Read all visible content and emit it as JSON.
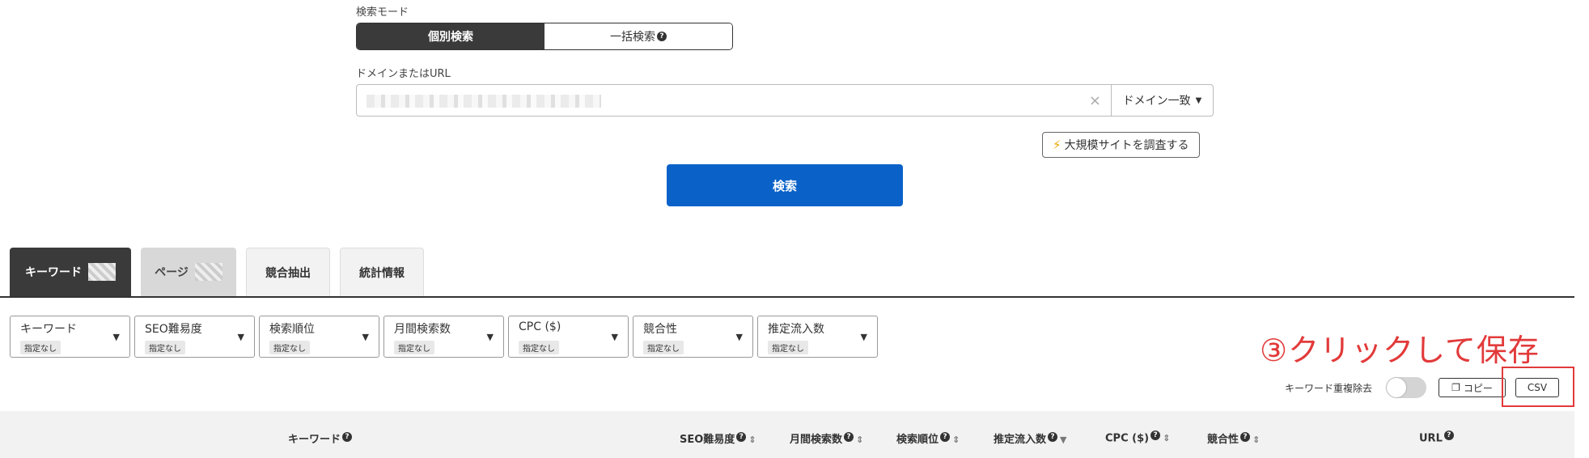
{
  "search_mode": {
    "label": "検索モード",
    "individual": "個別検索",
    "bulk": "一括検索"
  },
  "domain": {
    "label": "ドメインまたはURL",
    "match_select": "ドメイン一致"
  },
  "big_site_button": "大規模サイトを調査する",
  "search_button": "検索",
  "tabs": {
    "keyword": "キーワード",
    "page": "ページ",
    "competitor": "競合抽出",
    "stats": "統計情報"
  },
  "filters": [
    {
      "label": "キーワード",
      "badge": "指定なし"
    },
    {
      "label": "SEO難易度",
      "badge": "指定なし"
    },
    {
      "label": "検索順位",
      "badge": "指定なし"
    },
    {
      "label": "月間検索数",
      "badge": "指定なし"
    },
    {
      "label": "CPC ($)",
      "badge": "指定なし"
    },
    {
      "label": "競合性",
      "badge": "指定なし"
    },
    {
      "label": "推定流入数",
      "badge": "指定なし"
    }
  ],
  "annotation": "③クリックして保存",
  "tools": {
    "dedupe_label": "キーワード重複除去",
    "copy": "コピー",
    "csv": "CSV"
  },
  "columns": {
    "keyword": "キーワード",
    "seo": "SEO難易度",
    "monthly": "月間検索数",
    "rank": "検索順位",
    "traffic": "推定流入数",
    "cpc": "CPC ($)",
    "competition": "競合性",
    "url": "URL"
  },
  "colors": {
    "primary": "#0a62c9",
    "annotation": "#e23a3a",
    "dark": "#3a3a3a"
  }
}
